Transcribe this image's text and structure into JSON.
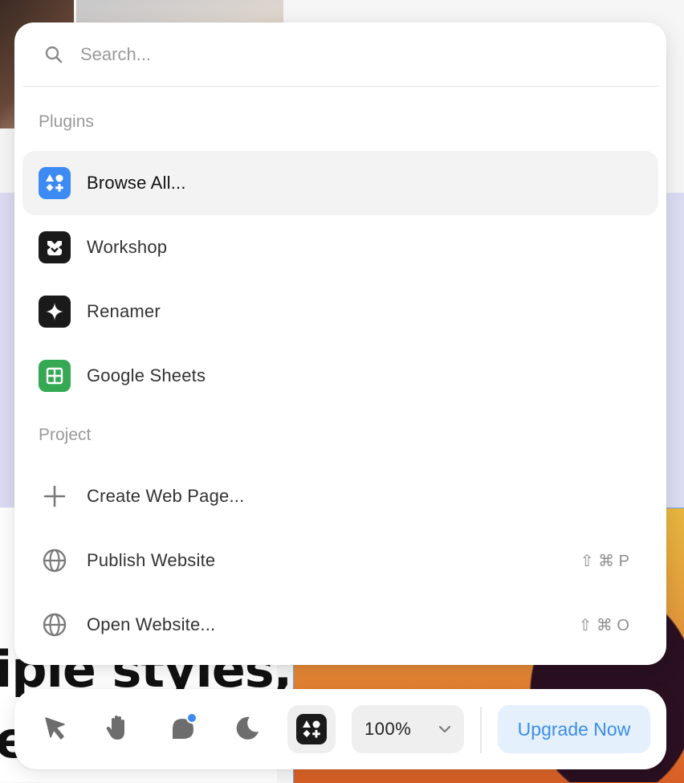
{
  "search": {
    "placeholder": "Search..."
  },
  "sections": {
    "plugins": "Plugins",
    "project": "Project"
  },
  "plugins": [
    {
      "label": "Browse All...",
      "icon": "shapes-icon",
      "icon_bg": "#3d8bf2",
      "selected": true
    },
    {
      "label": "Workshop",
      "icon": "workshop-icon",
      "icon_bg": "#1a1a1a"
    },
    {
      "label": "Renamer",
      "icon": "sparkle-icon",
      "icon_bg": "#1a1a1a"
    },
    {
      "label": "Google Sheets",
      "icon": "sheets-icon",
      "icon_bg": "#34a853"
    }
  ],
  "project": [
    {
      "label": "Create Web Page...",
      "icon": "plus-icon"
    },
    {
      "label": "Publish Website",
      "icon": "globe-icon",
      "shortcut": "⇧ ⌘ P"
    },
    {
      "label": "Open Website...",
      "icon": "globe-icon",
      "shortcut": "⇧ ⌘ O"
    }
  ],
  "toolbar": {
    "tools": [
      "pointer-icon",
      "hand-icon",
      "comment-icon",
      "dark-mode-icon",
      "plugins-icon"
    ],
    "zoom": "100%",
    "upgrade_label": "Upgrade Now"
  },
  "background": {
    "visible_text_line1": "iple styles,",
    "visible_text_line2": "e"
  },
  "colors": {
    "accent": "#3b8de6",
    "selected_row": "#f3f3f4",
    "notification_dot": "#3d8bf2"
  }
}
